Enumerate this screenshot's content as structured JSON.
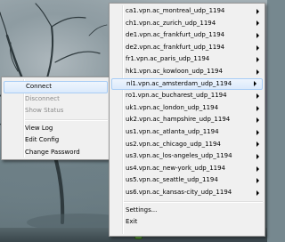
{
  "context_menu": {
    "items": [
      {
        "label": "Connect",
        "state": "highlighted"
      },
      {
        "label": "Disconnect",
        "state": "disabled"
      },
      {
        "label": "Show Status",
        "state": "disabled"
      },
      {
        "label": "View Log",
        "state": "normal"
      },
      {
        "label": "Edit Config",
        "state": "normal"
      },
      {
        "label": "Change Password",
        "state": "normal"
      }
    ]
  },
  "vpn_menu": {
    "connections": [
      {
        "label": "ca1.vpn.ac_montreal_udp_1194"
      },
      {
        "label": "ch1.vpn.ac_zurich_udp_1194"
      },
      {
        "label": "de1.vpn.ac_frankfurt_udp_1194"
      },
      {
        "label": "de2.vpn.ac_frankfurt_udp_1194"
      },
      {
        "label": "fr1.vpn.ac_paris_udp_1194"
      },
      {
        "label": "hk1.vpn.ac_kowloon_udp_1194"
      },
      {
        "label": "nl1.vpn.ac_amsterdam_udp_1194"
      },
      {
        "label": "ro1.vpn.ac_bucharest_udp_1194"
      },
      {
        "label": "uk1.vpn.ac_london_udp_1194"
      },
      {
        "label": "uk2.vpn.ac_hampshire_udp_1194"
      },
      {
        "label": "us1.vpn.ac_atlanta_udp_1194"
      },
      {
        "label": "us2.vpn.ac_chicago_udp_1194"
      },
      {
        "label": "us3.vpn.ac_los-angeles_udp_1194"
      },
      {
        "label": "us4.vpn.ac_new-york_udp_1194"
      },
      {
        "label": "us5.vpn.ac_seattle_udp_1194"
      },
      {
        "label": "us6.vpn.ac_kansas-city_udp_1194"
      }
    ],
    "selected": "nl1.vpn.ac_amsterdam_udp_1194",
    "settings_label": "Settings...",
    "exit_label": "Exit"
  },
  "colors": {
    "menu_bg": "#f0f0f0",
    "highlight_bg": "#dbeafb",
    "highlight_border": "#a8cdf5",
    "disabled_text": "#8b8b8b"
  }
}
